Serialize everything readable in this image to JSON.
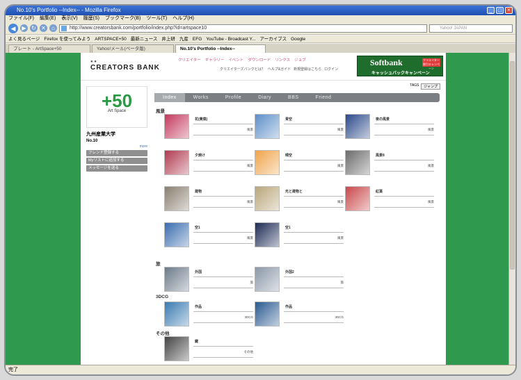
{
  "window": {
    "title": "No.10's Portfolio --Index-- - Mozilla Firefox"
  },
  "menu": [
    "ファイル(F)",
    "編集(E)",
    "表示(V)",
    "履歴(S)",
    "ブックマーク(B)",
    "ツール(T)",
    "ヘルプ(H)"
  ],
  "nav": {
    "url": "http://www.creatorsbank.com/portfolio/index.php?id=artspace10",
    "search_placeholder": "Yahoo! JAPAN"
  },
  "bookmarks": [
    "よく見るページ",
    "Firefox を使ってみよう",
    "ARTSPACE+50",
    "最新ニュース",
    "井上研",
    "九産",
    "EFG",
    "YouTube - Broadcast Y...",
    "アーカイブス",
    "Google"
  ],
  "tabs": [
    {
      "label": "プレート - ArtSpace+50"
    },
    {
      "label": "Yahoo!メール(ベータ版)"
    },
    {
      "label": "No.10's Portfolio --Index--"
    }
  ],
  "status": "完了",
  "site": {
    "logo": "CREATORS BANK",
    "top_nav": [
      "クリエイター",
      "ギャラリー",
      "イベント",
      "ダウンロード",
      "リンクス",
      "ジョブ"
    ],
    "sub_nav": [
      "クリエイターズバンクとは？",
      "ヘルプ&ガイド",
      "新規登録はこちら",
      "ログイン"
    ],
    "banner": {
      "title": "Softbank",
      "subtitle": "キャッシュバックキャンペーン",
      "tag": "クリエイター割引キャンペーン"
    },
    "top_right": {
      "link": "TAGS",
      "jump": "ジャンプ"
    }
  },
  "profile": {
    "logo_num": "+50",
    "logo_sub": "Art Space",
    "name": "九州産業大学",
    "number": "No.10",
    "more": "more",
    "buttons": [
      "フレンド登録する",
      "Myリストに追加する",
      "メッセージを送る"
    ]
  },
  "page_tabs": [
    "Index",
    "Works",
    "Profile",
    "Diary",
    "BBS",
    "Friend"
  ],
  "sections": [
    {
      "title": "風景",
      "items": [
        {
          "name": "花(黄菜)",
          "cat": "風景",
          "color": "#c33a5e"
        },
        {
          "name": "青空",
          "cat": "風景",
          "color": "#5d8fc9"
        },
        {
          "name": "夜の風景",
          "cat": "風景",
          "color": "#2c4a8a"
        },
        {
          "name": "夕焼け",
          "cat": "風景",
          "color": "#b03a4f"
        },
        {
          "name": "晴空",
          "cat": "風景",
          "color": "#f0a44a"
        },
        {
          "name": "風景8",
          "cat": "風景",
          "color": "#6b6b6b"
        },
        {
          "name": "建物",
          "cat": "風景",
          "color": "#8a7f70"
        },
        {
          "name": "光と建物と",
          "cat": "風景",
          "color": "#b9a67a"
        },
        {
          "name": "紅葉",
          "cat": "風景",
          "color": "#c9484a"
        },
        {
          "name": "空1",
          "cat": "風景",
          "color": "#3a6dae"
        },
        {
          "name": "空1",
          "cat": "風景",
          "color": "#1c2a55"
        }
      ]
    },
    {
      "title": "旅",
      "items": [
        {
          "name": "外国",
          "cat": "旅",
          "color": "#6b7a8a"
        },
        {
          "name": "外国2",
          "cat": "旅",
          "color": "#8a98a8"
        }
      ]
    },
    {
      "title": "3DCG",
      "items": [
        {
          "name": "作品",
          "cat": "3DCG",
          "color": "#3a7ab0"
        },
        {
          "name": "作品",
          "cat": "3DCG",
          "color": "#2a5a90"
        }
      ]
    },
    {
      "title": "その他",
      "items": [
        {
          "name": "鍵",
          "cat": "その他",
          "color": "#444444"
        }
      ]
    }
  ]
}
